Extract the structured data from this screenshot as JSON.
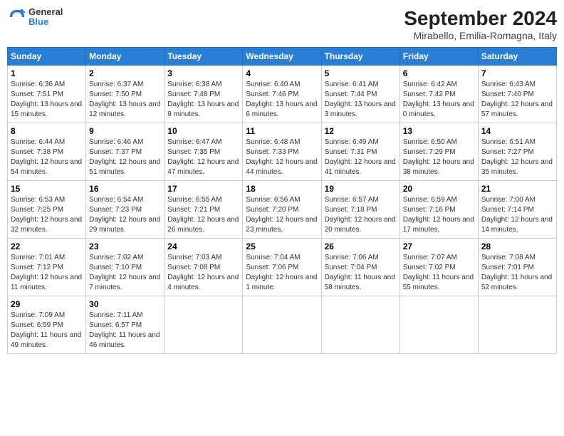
{
  "header": {
    "logo_line1": "General",
    "logo_line2": "Blue",
    "title": "September 2024",
    "subtitle": "Mirabello, Emilia-Romagna, Italy"
  },
  "days_of_week": [
    "Sunday",
    "Monday",
    "Tuesday",
    "Wednesday",
    "Thursday",
    "Friday",
    "Saturday"
  ],
  "weeks": [
    [
      {
        "day": 1,
        "sunrise": "6:36 AM",
        "sunset": "7:51 PM",
        "daylight": "13 hours and 15 minutes."
      },
      {
        "day": 2,
        "sunrise": "6:37 AM",
        "sunset": "7:50 PM",
        "daylight": "13 hours and 12 minutes."
      },
      {
        "day": 3,
        "sunrise": "6:38 AM",
        "sunset": "7:48 PM",
        "daylight": "13 hours and 9 minutes."
      },
      {
        "day": 4,
        "sunrise": "6:40 AM",
        "sunset": "7:46 PM",
        "daylight": "13 hours and 6 minutes."
      },
      {
        "day": 5,
        "sunrise": "6:41 AM",
        "sunset": "7:44 PM",
        "daylight": "13 hours and 3 minutes."
      },
      {
        "day": 6,
        "sunrise": "6:42 AM",
        "sunset": "7:42 PM",
        "daylight": "13 hours and 0 minutes."
      },
      {
        "day": 7,
        "sunrise": "6:43 AM",
        "sunset": "7:40 PM",
        "daylight": "12 hours and 57 minutes."
      }
    ],
    [
      {
        "day": 8,
        "sunrise": "6:44 AM",
        "sunset": "7:38 PM",
        "daylight": "12 hours and 54 minutes."
      },
      {
        "day": 9,
        "sunrise": "6:46 AM",
        "sunset": "7:37 PM",
        "daylight": "12 hours and 51 minutes."
      },
      {
        "day": 10,
        "sunrise": "6:47 AM",
        "sunset": "7:35 PM",
        "daylight": "12 hours and 47 minutes."
      },
      {
        "day": 11,
        "sunrise": "6:48 AM",
        "sunset": "7:33 PM",
        "daylight": "12 hours and 44 minutes."
      },
      {
        "day": 12,
        "sunrise": "6:49 AM",
        "sunset": "7:31 PM",
        "daylight": "12 hours and 41 minutes."
      },
      {
        "day": 13,
        "sunrise": "6:50 AM",
        "sunset": "7:29 PM",
        "daylight": "12 hours and 38 minutes."
      },
      {
        "day": 14,
        "sunrise": "6:51 AM",
        "sunset": "7:27 PM",
        "daylight": "12 hours and 35 minutes."
      }
    ],
    [
      {
        "day": 15,
        "sunrise": "6:53 AM",
        "sunset": "7:25 PM",
        "daylight": "12 hours and 32 minutes."
      },
      {
        "day": 16,
        "sunrise": "6:54 AM",
        "sunset": "7:23 PM",
        "daylight": "12 hours and 29 minutes."
      },
      {
        "day": 17,
        "sunrise": "6:55 AM",
        "sunset": "7:21 PM",
        "daylight": "12 hours and 26 minutes."
      },
      {
        "day": 18,
        "sunrise": "6:56 AM",
        "sunset": "7:20 PM",
        "daylight": "12 hours and 23 minutes."
      },
      {
        "day": 19,
        "sunrise": "6:57 AM",
        "sunset": "7:18 PM",
        "daylight": "12 hours and 20 minutes."
      },
      {
        "day": 20,
        "sunrise": "6:59 AM",
        "sunset": "7:16 PM",
        "daylight": "12 hours and 17 minutes."
      },
      {
        "day": 21,
        "sunrise": "7:00 AM",
        "sunset": "7:14 PM",
        "daylight": "12 hours and 14 minutes."
      }
    ],
    [
      {
        "day": 22,
        "sunrise": "7:01 AM",
        "sunset": "7:12 PM",
        "daylight": "12 hours and 11 minutes."
      },
      {
        "day": 23,
        "sunrise": "7:02 AM",
        "sunset": "7:10 PM",
        "daylight": "12 hours and 7 minutes."
      },
      {
        "day": 24,
        "sunrise": "7:03 AM",
        "sunset": "7:08 PM",
        "daylight": "12 hours and 4 minutes."
      },
      {
        "day": 25,
        "sunrise": "7:04 AM",
        "sunset": "7:06 PM",
        "daylight": "12 hours and 1 minute."
      },
      {
        "day": 26,
        "sunrise": "7:06 AM",
        "sunset": "7:04 PM",
        "daylight": "11 hours and 58 minutes."
      },
      {
        "day": 27,
        "sunrise": "7:07 AM",
        "sunset": "7:02 PM",
        "daylight": "11 hours and 55 minutes."
      },
      {
        "day": 28,
        "sunrise": "7:08 AM",
        "sunset": "7:01 PM",
        "daylight": "11 hours and 52 minutes."
      }
    ],
    [
      {
        "day": 29,
        "sunrise": "7:09 AM",
        "sunset": "6:59 PM",
        "daylight": "11 hours and 49 minutes."
      },
      {
        "day": 30,
        "sunrise": "7:11 AM",
        "sunset": "6:57 PM",
        "daylight": "11 hours and 46 minutes."
      },
      null,
      null,
      null,
      null,
      null
    ]
  ]
}
